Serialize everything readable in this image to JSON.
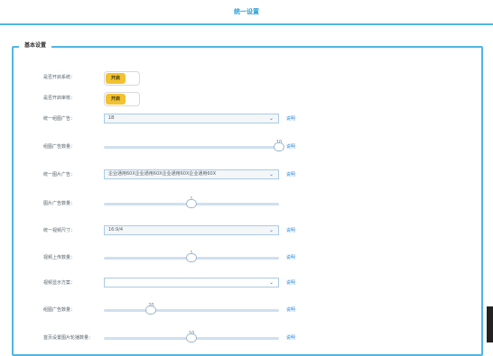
{
  "header": {
    "title": "统一设置"
  },
  "section": {
    "legend": "基本设置"
  },
  "rows": {
    "r1": {
      "label": "是否开启系统：",
      "toggle_label": "开启"
    },
    "r2": {
      "label": "是否开启审核：",
      "toggle_label": "开启"
    },
    "r3": {
      "label": "统一组图广告：",
      "select_value": "1B",
      "link": "说明"
    },
    "r4": {
      "label": "组图广告数量：",
      "slider_value": "10",
      "slider_fraction": 1.0,
      "link": "说明"
    },
    "r5": {
      "label": "统一图片广告：",
      "select_value": "企业通用60X企业通用60X企业通用60X企业通用60X",
      "link": "说明"
    },
    "r6": {
      "label": "图片广告数量：",
      "slider_value": "1",
      "slider_fraction": 0.5
    },
    "r7": {
      "label": "统一视频尺寸：",
      "select_value": "16:9/4",
      "link": "说明"
    },
    "r8": {
      "label": "视频上传数量：",
      "slider_value": "1",
      "slider_fraction": 0.5,
      "link": "说明"
    },
    "r9": {
      "label": "视频显示方案：",
      "select_value": "",
      "link": "说明"
    },
    "r10": {
      "label": "组图广告数量：",
      "slider_value": "20",
      "slider_fraction": 0.27,
      "link": "说明"
    },
    "r11": {
      "label": "首页设置图片轮播数量：",
      "slider_value": "10",
      "slider_fraction": 0.5,
      "link": "说明"
    }
  },
  "colors": {
    "accent": "#4fb6e3",
    "toggle_on": "#f1c232",
    "link": "#2a86d6"
  }
}
